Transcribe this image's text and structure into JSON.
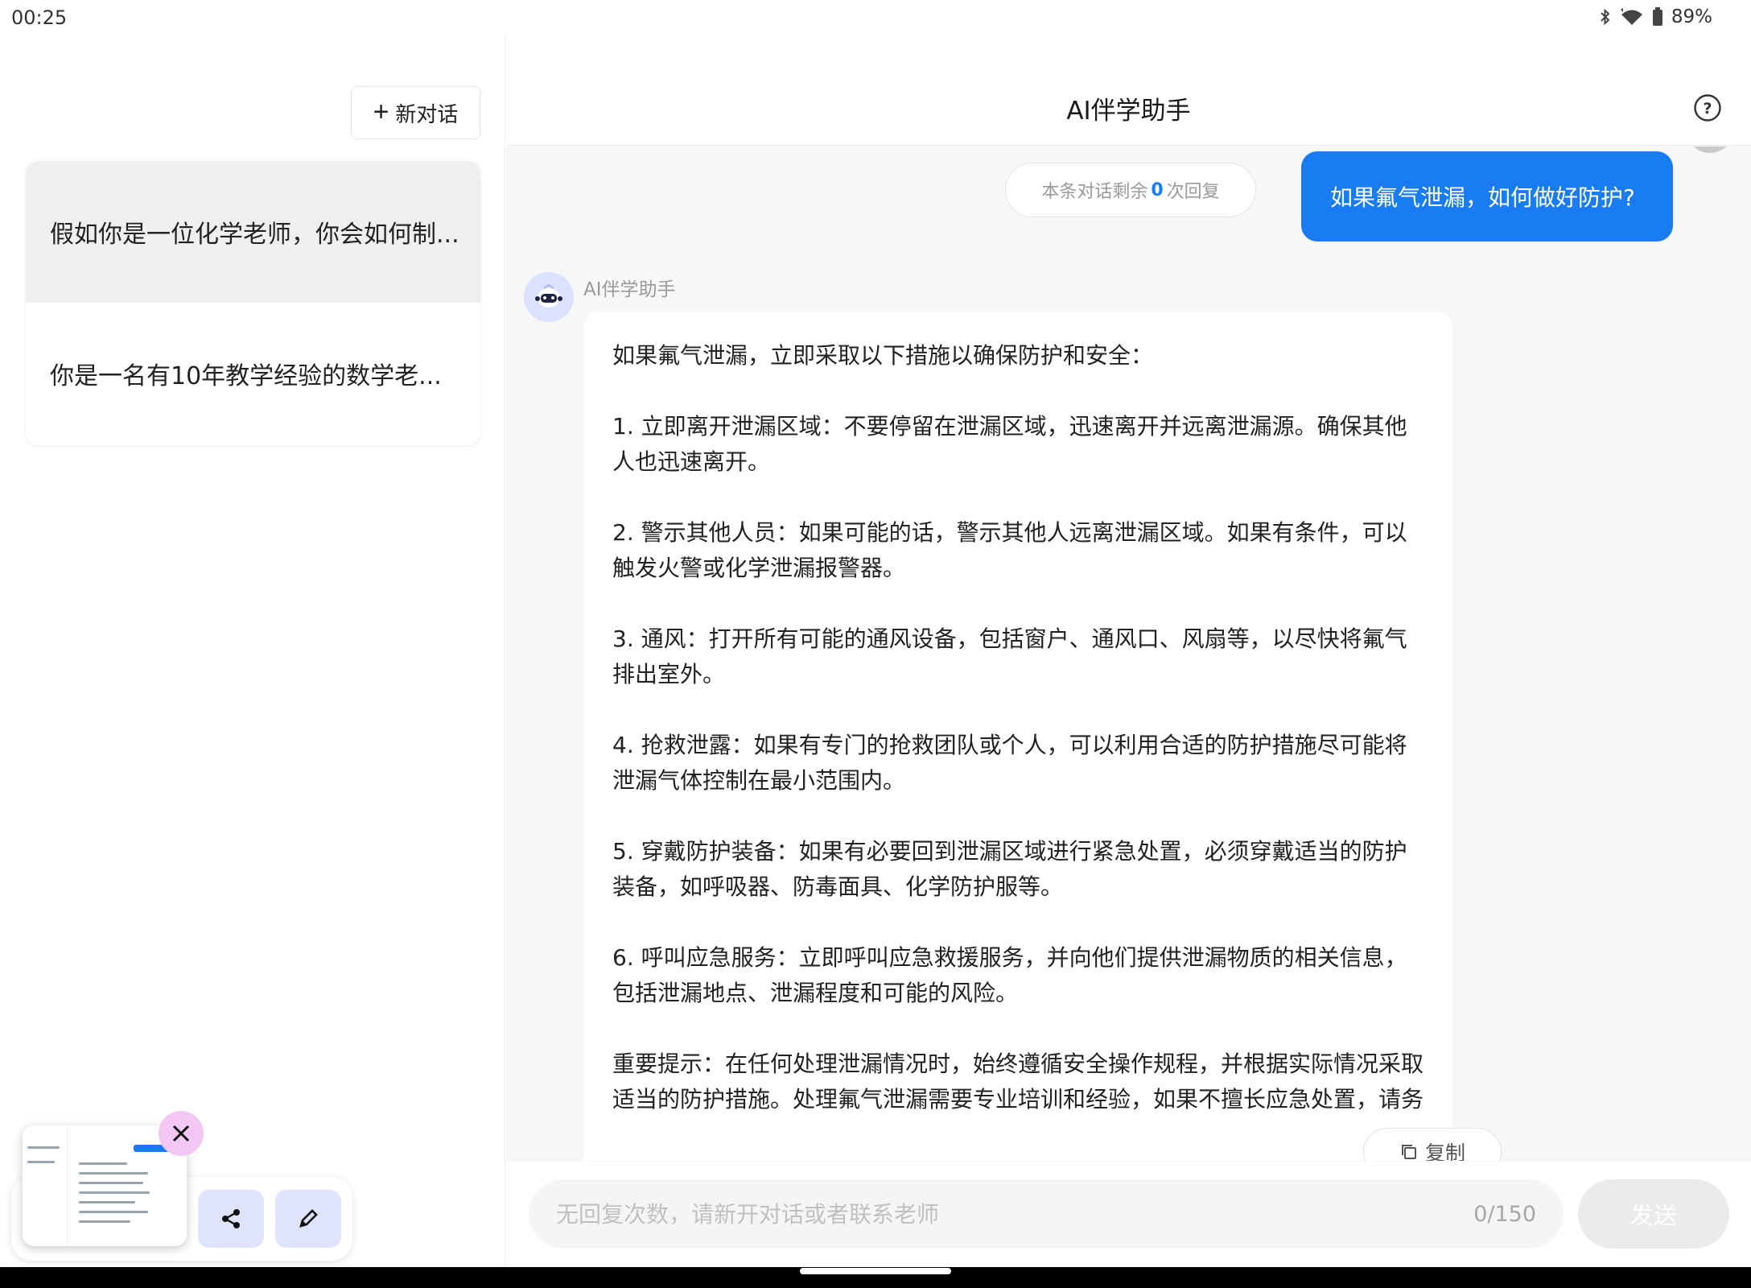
{
  "status": {
    "time": "00:25",
    "battery": "89%"
  },
  "sidebar": {
    "new_chat_label": "新对话",
    "history": [
      {
        "title": "假如你是一位化学老师，你会如何制..."
      },
      {
        "title": "你是一名有10年教学经验的数学老..."
      }
    ]
  },
  "header": {
    "title": "AI伴学助手"
  },
  "chat": {
    "remaining_prefix": "本条对话剩余",
    "remaining_count": "0",
    "remaining_suffix": "次回复",
    "user_message": "如果氟气泄漏，如何做好防护?",
    "bot_name": "AI伴学助手",
    "answer_paragraphs": [
      "如果氟气泄漏，立即采取以下措施以确保防护和安全：",
      "1. 立即离开泄漏区域：不要停留在泄漏区域，迅速离开并远离泄漏源。确保其他人也迅速离开。",
      "2. 警示其他人员：如果可能的话，警示其他人远离泄漏区域。如果有条件，可以触发火警或化学泄漏报警器。",
      "3. 通风：打开所有可能的通风设备，包括窗户、通风口、风扇等，以尽快将氟气排出室外。",
      "4. 抢救泄露：如果有专门的抢救团队或个人，可以利用合适的防护措施尽可能将泄漏气体控制在最小范围内。",
      "5. 穿戴防护装备：如果有必要回到泄漏区域进行紧急处置，必须穿戴适当的防护装备，如呼吸器、防毒面具、化学防护服等。",
      "6. 呼叫应急服务：立即呼叫应急救援服务，并向他们提供泄漏物质的相关信息，包括泄漏地点、泄漏程度和可能的风险。",
      "重要提示：在任何处理泄漏情况时，始终遵循安全操作规程，并根据实际情况采取适当的防护措施。处理氟气泄漏需要专业培训和经验，如果不擅长应急处置，请务"
    ],
    "copy_label": "复制"
  },
  "composer": {
    "placeholder": "无回复次数，请新开对话或者联系老师",
    "counter": "0/150",
    "send_label": "发送"
  },
  "colors": {
    "accent": "#1a7cf2",
    "bot_avatar_bg": "#dbe1ff",
    "fab_bg": "#dfe3fb",
    "close_bg": "#f3c7f3"
  }
}
